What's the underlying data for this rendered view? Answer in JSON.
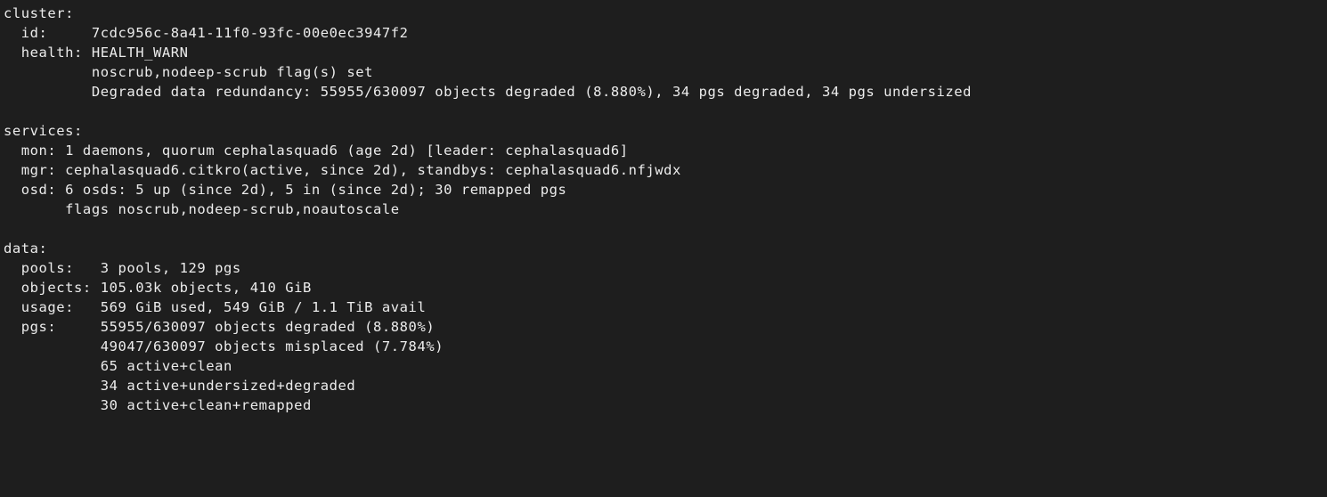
{
  "cluster": {
    "heading": "cluster:",
    "id_line": "  id:     7cdc956c-8a41-11f0-93fc-00e0ec3947f2",
    "health_line": "  health: HEALTH_WARN",
    "health_detail_1": "          noscrub,nodeep-scrub flag(s) set",
    "health_detail_2": "          Degraded data redundancy: 55955/630097 objects degraded (8.880%), 34 pgs degraded, 34 pgs undersized"
  },
  "services": {
    "heading": "services:",
    "mon_line": "  mon: 1 daemons, quorum cephalasquad6 (age 2d) [leader: cephalasquad6]",
    "mgr_line": "  mgr: cephalasquad6.citkro(active, since 2d), standbys: cephalasquad6.nfjwdx",
    "osd_line": "  osd: 6 osds: 5 up (since 2d), 5 in (since 2d); 30 remapped pgs",
    "osd_flags_line": "       flags noscrub,nodeep-scrub,noautoscale"
  },
  "data": {
    "heading": "data:",
    "pools_line": "  pools:   3 pools, 129 pgs",
    "objects_line": "  objects: 105.03k objects, 410 GiB",
    "usage_line": "  usage:   569 GiB used, 549 GiB / 1.1 TiB avail",
    "pgs_line_1": "  pgs:     55955/630097 objects degraded (8.880%)",
    "pgs_line_2": "           49047/630097 objects misplaced (7.784%)",
    "pgs_line_3": "           65 active+clean",
    "pgs_line_4": "           34 active+undersized+degraded",
    "pgs_line_5": "           30 active+clean+remapped"
  }
}
